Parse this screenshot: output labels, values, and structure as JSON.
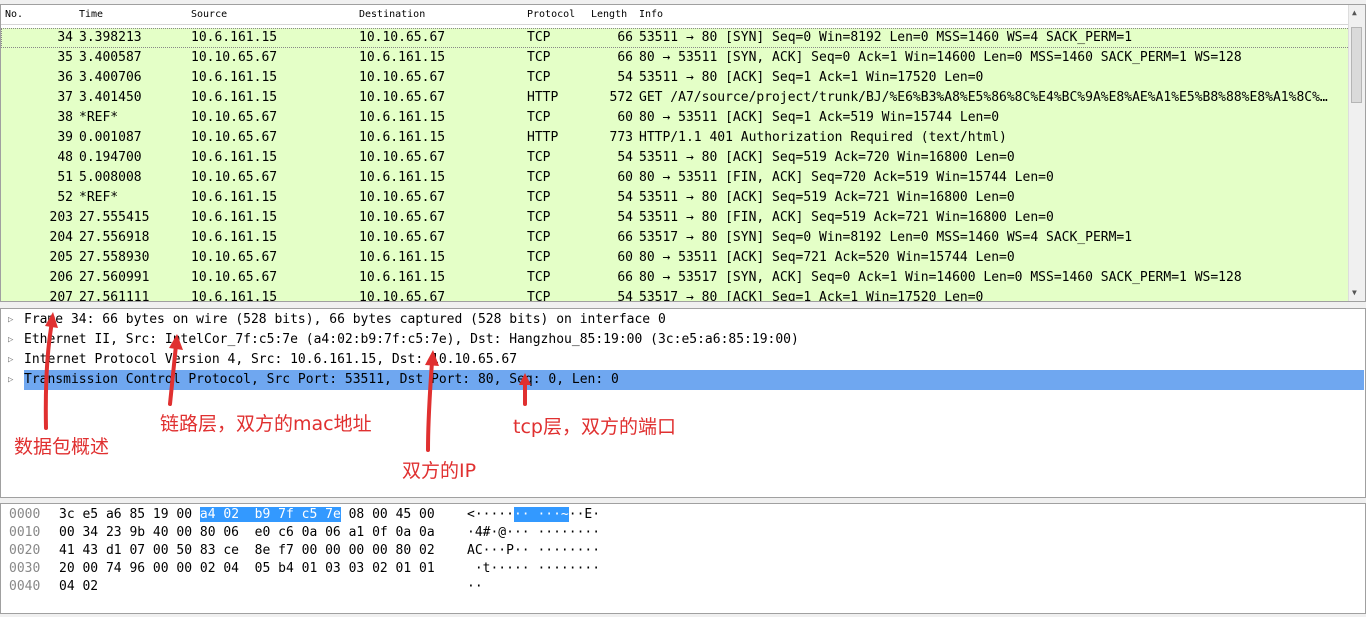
{
  "packet_list": {
    "columns": [
      "No.",
      "Time",
      "Source",
      "Destination",
      "Protocol",
      "Length",
      "Info"
    ],
    "rows": [
      {
        "no": "34",
        "time": "3.398213",
        "src": "10.6.161.15",
        "dst": "10.10.65.67",
        "proto": "TCP",
        "len": "66",
        "info": "53511 → 80 [SYN] Seq=0 Win=8192 Len=0 MSS=1460 WS=4 SACK_PERM=1"
      },
      {
        "no": "35",
        "time": "3.400587",
        "src": "10.10.65.67",
        "dst": "10.6.161.15",
        "proto": "TCP",
        "len": "66",
        "info": "80 → 53511 [SYN, ACK] Seq=0 Ack=1 Win=14600 Len=0 MSS=1460 SACK_PERM=1 WS=128"
      },
      {
        "no": "36",
        "time": "3.400706",
        "src": "10.6.161.15",
        "dst": "10.10.65.67",
        "proto": "TCP",
        "len": "54",
        "info": "53511 → 80 [ACK] Seq=1 Ack=1 Win=17520 Len=0"
      },
      {
        "no": "37",
        "time": "3.401450",
        "src": "10.6.161.15",
        "dst": "10.10.65.67",
        "proto": "HTTP",
        "len": "572",
        "info": "GET /A7/source/project/trunk/BJ/%E6%B3%A8%E5%86%8C%E4%BC%9A%E8%AE%A1%E5%B8%88%E8%A1%8C%…"
      },
      {
        "no": "38",
        "time": "*REF*",
        "src": "10.10.65.67",
        "dst": "10.6.161.15",
        "proto": "TCP",
        "len": "60",
        "info": "80 → 53511 [ACK] Seq=1 Ack=519 Win=15744 Len=0"
      },
      {
        "no": "39",
        "time": "0.001087",
        "src": "10.10.65.67",
        "dst": "10.6.161.15",
        "proto": "HTTP",
        "len": "773",
        "info": "HTTP/1.1 401 Authorization Required  (text/html)"
      },
      {
        "no": "48",
        "time": "0.194700",
        "src": "10.6.161.15",
        "dst": "10.10.65.67",
        "proto": "TCP",
        "len": "54",
        "info": "53511 → 80 [ACK] Seq=519 Ack=720 Win=16800 Len=0"
      },
      {
        "no": "51",
        "time": "5.008008",
        "src": "10.10.65.67",
        "dst": "10.6.161.15",
        "proto": "TCP",
        "len": "60",
        "info": "80 → 53511 [FIN, ACK] Seq=720 Ack=519 Win=15744 Len=0"
      },
      {
        "no": "52",
        "time": "*REF*",
        "src": "10.6.161.15",
        "dst": "10.10.65.67",
        "proto": "TCP",
        "len": "54",
        "info": "53511 → 80 [ACK] Seq=519 Ack=721 Win=16800 Len=0"
      },
      {
        "no": "203",
        "time": "27.555415",
        "src": "10.6.161.15",
        "dst": "10.10.65.67",
        "proto": "TCP",
        "len": "54",
        "info": "53511 → 80 [FIN, ACK] Seq=519 Ack=721 Win=16800 Len=0"
      },
      {
        "no": "204",
        "time": "27.556918",
        "src": "10.6.161.15",
        "dst": "10.10.65.67",
        "proto": "TCP",
        "len": "66",
        "info": "53517 → 80 [SYN] Seq=0 Win=8192 Len=0 MSS=1460 WS=4 SACK_PERM=1"
      },
      {
        "no": "205",
        "time": "27.558930",
        "src": "10.10.65.67",
        "dst": "10.6.161.15",
        "proto": "TCP",
        "len": "60",
        "info": "80 → 53511 [ACK] Seq=721 Ack=520 Win=15744 Len=0"
      },
      {
        "no": "206",
        "time": "27.560991",
        "src": "10.10.65.67",
        "dst": "10.6.161.15",
        "proto": "TCP",
        "len": "66",
        "info": "80 → 53517 [SYN, ACK] Seq=0 Ack=1 Win=14600 Len=0 MSS=1460 SACK_PERM=1 WS=128"
      },
      {
        "no": "207",
        "time": "27.561111",
        "src": "10.6.161.15",
        "dst": "10.10.65.67",
        "proto": "TCP",
        "len": "54",
        "info": "53517 → 80 [ACK] Seq=1 Ack=1 Win=17520 Len=0"
      }
    ]
  },
  "details": {
    "rows": [
      "Frame 34: 66 bytes on wire (528 bits), 66 bytes captured (528 bits) on interface 0",
      "Ethernet II, Src: IntelCor_7f:c5:7e (a4:02:b9:7f:c5:7e), Dst: Hangzhou_85:19:00 (3c:e5:a6:85:19:00)",
      "Internet Protocol Version 4, Src: 10.6.161.15, Dst: 10.10.65.67",
      "Transmission Control Protocol, Src Port: 53511, Dst Port: 80, Seq: 0, Len: 0"
    ],
    "expander_icon": "triangle-right-icon"
  },
  "hex": {
    "rows": [
      {
        "offset": "0000",
        "pre": "3c e5 a6 85 19 00 ",
        "hl": "a4 02  b9 7f c5 7e",
        "post": " 08 00 45 00",
        "a_pre": "<·····",
        "a_hl": "·· ···~",
        "a_post": "··E·"
      },
      {
        "offset": "0010",
        "pre": "00 34 23 9b 40 00 80 06  e0 c6 0a 06 a1 0f 0a 0a",
        "hl": "",
        "post": "",
        "a_pre": "·4#·@··· ········",
        "a_hl": "",
        "a_post": ""
      },
      {
        "offset": "0020",
        "pre": "41 43 d1 07 00 50 83 ce  8e f7 00 00 00 00 80 02",
        "hl": "",
        "post": "",
        "a_pre": "AC···P·· ········",
        "a_hl": "",
        "a_post": ""
      },
      {
        "offset": "0030",
        "pre": "20 00 74 96 00 00 02 04  05 b4 01 03 03 02 01 01",
        "hl": "",
        "post": "",
        "a_pre": " ·t····· ········",
        "a_hl": "",
        "a_post": ""
      },
      {
        "offset": "0040",
        "pre": "04 02",
        "hl": "",
        "post": "",
        "a_pre": "··",
        "a_hl": "",
        "a_post": ""
      }
    ]
  },
  "annotations": {
    "overview": "数据包概述",
    "link_layer": "链路层，双方的mac地址",
    "ip": "双方的IP",
    "tcp": "tcp层，双方的端口",
    "color": "#e03030"
  },
  "colors": {
    "row_bg": "#e4ffc7",
    "selected_detail_bg": "#6fa7f0",
    "hex_highlight": "#3399ff"
  }
}
